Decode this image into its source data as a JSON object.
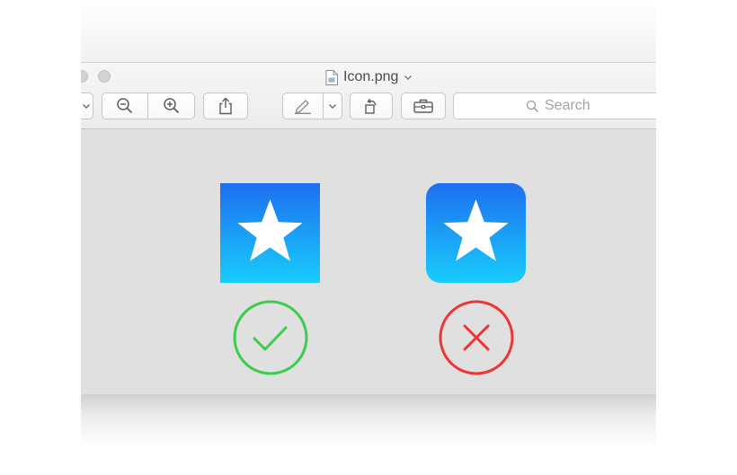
{
  "window": {
    "title": "Icon.png"
  },
  "toolbar": {
    "search": {
      "placeholder": "Search"
    },
    "buttons": [
      {
        "name": "view-menu-chevron",
        "icon": "chevron-down-icon"
      },
      {
        "name": "zoom-out-button",
        "icon": "zoom-out-icon"
      },
      {
        "name": "zoom-in-button",
        "icon": "zoom-in-icon"
      },
      {
        "name": "share-button",
        "icon": "share-icon"
      },
      {
        "name": "markup-button",
        "icon": "pen-icon"
      },
      {
        "name": "markup-menu-button",
        "icon": "chevron-down-icon"
      },
      {
        "name": "rotate-button",
        "icon": "rotate-icon"
      },
      {
        "name": "toolbox-button",
        "icon": "toolbox-icon"
      }
    ]
  },
  "content": {
    "icons": [
      {
        "shape": "square",
        "icon": "star-icon",
        "status": "correct",
        "status_icon": "checkmark-icon",
        "status_color": "#3ccd4c"
      },
      {
        "shape": "rounded",
        "icon": "star-icon",
        "status": "incorrect",
        "status_icon": "cross-icon",
        "status_color": "#ee3535"
      }
    ],
    "colors": {
      "gradient_top": "#1e6ef0",
      "gradient_bottom": "#18cdfc",
      "canvas": "#e0e0e0"
    }
  }
}
